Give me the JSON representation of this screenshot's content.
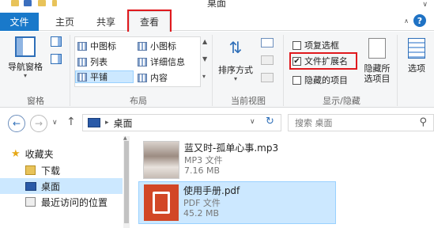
{
  "window": {
    "title": "桌面"
  },
  "tabs": {
    "file": "文件",
    "home": "主页",
    "share": "共享",
    "view": "查看"
  },
  "ribbon": {
    "pane": {
      "nav_pane_label": "导航窗格",
      "group_label": "窗格"
    },
    "layout": {
      "items": [
        "中图标",
        "小图标",
        "列表",
        "详细信息",
        "平铺",
        "内容"
      ],
      "selected": "平铺",
      "group_label": "布局"
    },
    "current_view": {
      "sort_label": "排序方式",
      "group_label": "当前视图"
    },
    "show_hide": {
      "item_checkboxes": "项复选框",
      "file_extensions": "文件扩展名",
      "hidden_items": "隐藏的项目",
      "hide_selected": "隐藏所\n选项目",
      "group_label": "显示/隐藏"
    },
    "options": {
      "label": "选项"
    }
  },
  "address": {
    "path": "桌面",
    "search_placeholder": "搜索 桌面"
  },
  "nav_pane": {
    "items": [
      {
        "label": "收藏夹",
        "icon": "star-icon"
      },
      {
        "label": "下载",
        "icon": "download-folder-icon"
      },
      {
        "label": "桌面",
        "icon": "desktop-icon"
      },
      {
        "label": "最近访问的位置",
        "icon": "recent-places-icon"
      }
    ]
  },
  "files": [
    {
      "name": "蓝又时-孤单心事.mp3",
      "type": "MP3 文件",
      "size": "7.16 MB"
    },
    {
      "name": "使用手册.pdf",
      "type": "PDF 文件",
      "size": "45.2 MB"
    }
  ]
}
